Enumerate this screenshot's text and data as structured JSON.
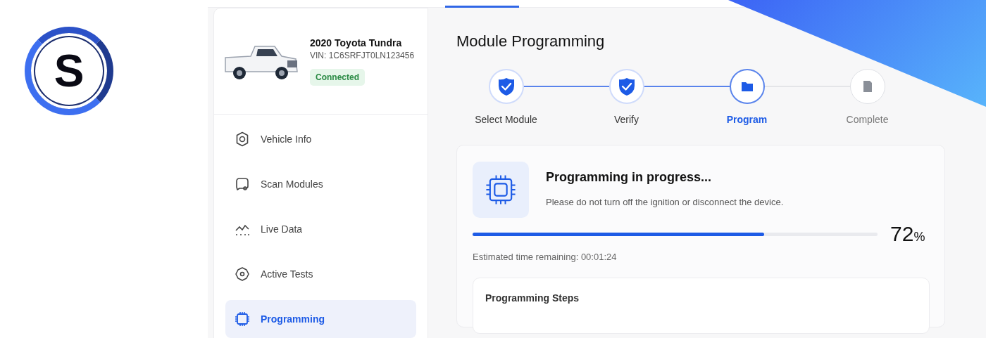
{
  "logo": {
    "letter": "S"
  },
  "vehicle": {
    "name": "2020 Toyota Tundra",
    "vin": "VIN: 1C6SRFJT0LN123456",
    "status": "Connected"
  },
  "sidebar": {
    "items": [
      {
        "label": "Vehicle Info",
        "kind": "gear",
        "selected": false
      },
      {
        "label": "Scan Modules",
        "kind": "scan",
        "selected": false
      },
      {
        "label": "Live Data",
        "kind": "graph",
        "selected": false
      },
      {
        "label": "Active Tests",
        "kind": "test",
        "selected": false
      },
      {
        "label": "Programming",
        "kind": "chip",
        "selected": true
      }
    ]
  },
  "main": {
    "title": "Module Programming",
    "steps": [
      {
        "label": "Select Module",
        "completed": true,
        "selected": false
      },
      {
        "label": "Verify",
        "completed": true,
        "selected": false
      },
      {
        "label": "Program",
        "completed": false,
        "selected": true
      },
      {
        "label": "Complete",
        "completed": false,
        "selected": false
      }
    ],
    "progress": {
      "title": "Programming in progress...",
      "message": "Please do not turn off the ignition or disconnect the device.",
      "level": 0.72,
      "percent": "72",
      "unit": "%",
      "eta": "Estimated time remaining: 00:01:24"
    },
    "steps_panel": {
      "title": "Programming Steps"
    }
  }
}
